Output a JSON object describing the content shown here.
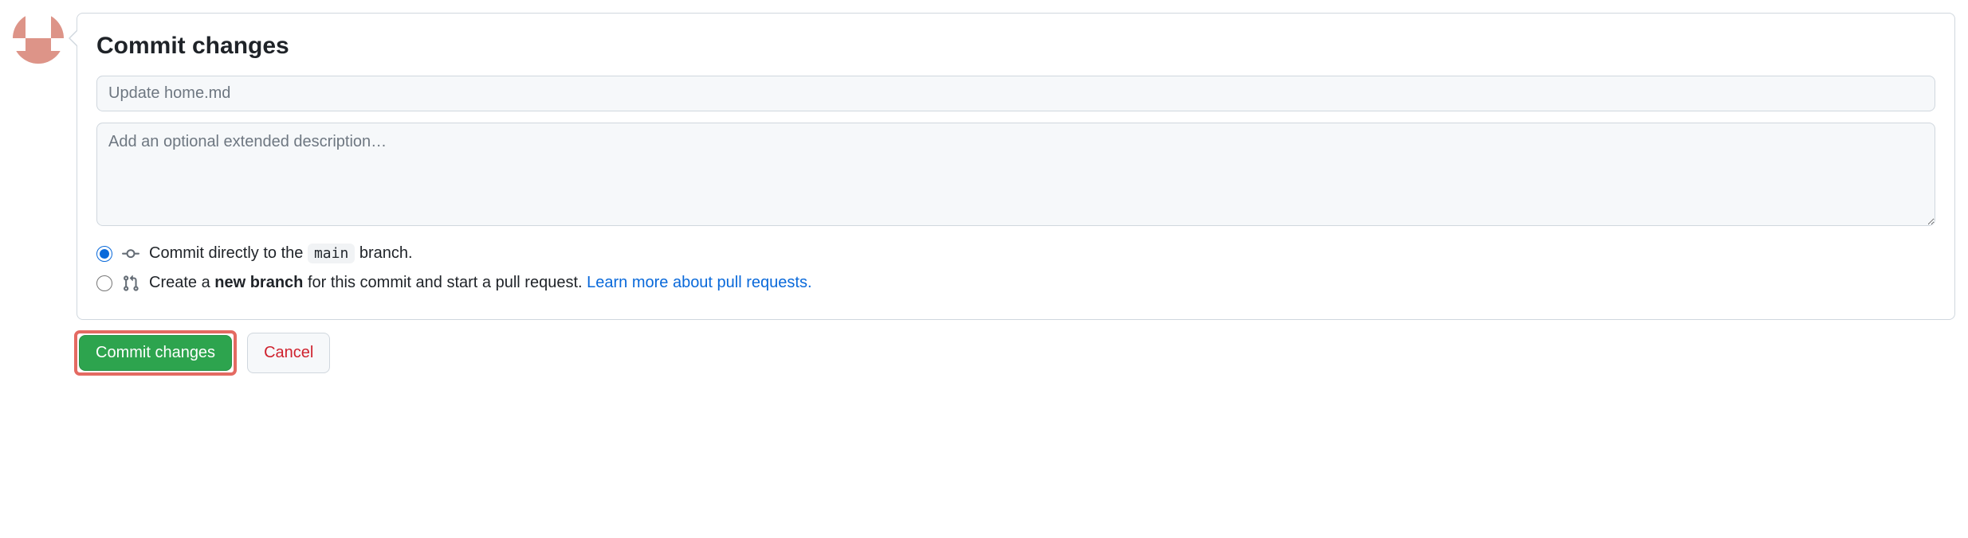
{
  "panel": {
    "title": "Commit changes",
    "summary_placeholder": "Update home.md",
    "summary_value": "",
    "description_placeholder": "Add an optional extended description…",
    "description_value": ""
  },
  "radio_options": {
    "direct": {
      "prefix": "Commit directly to the ",
      "branch_name": "main",
      "suffix": " branch."
    },
    "new_branch": {
      "prefix": "Create a ",
      "strong": "new branch",
      "middle": " for this commit and start a pull request. ",
      "link": "Learn more about pull requests."
    }
  },
  "actions": {
    "commit": "Commit changes",
    "cancel": "Cancel"
  }
}
